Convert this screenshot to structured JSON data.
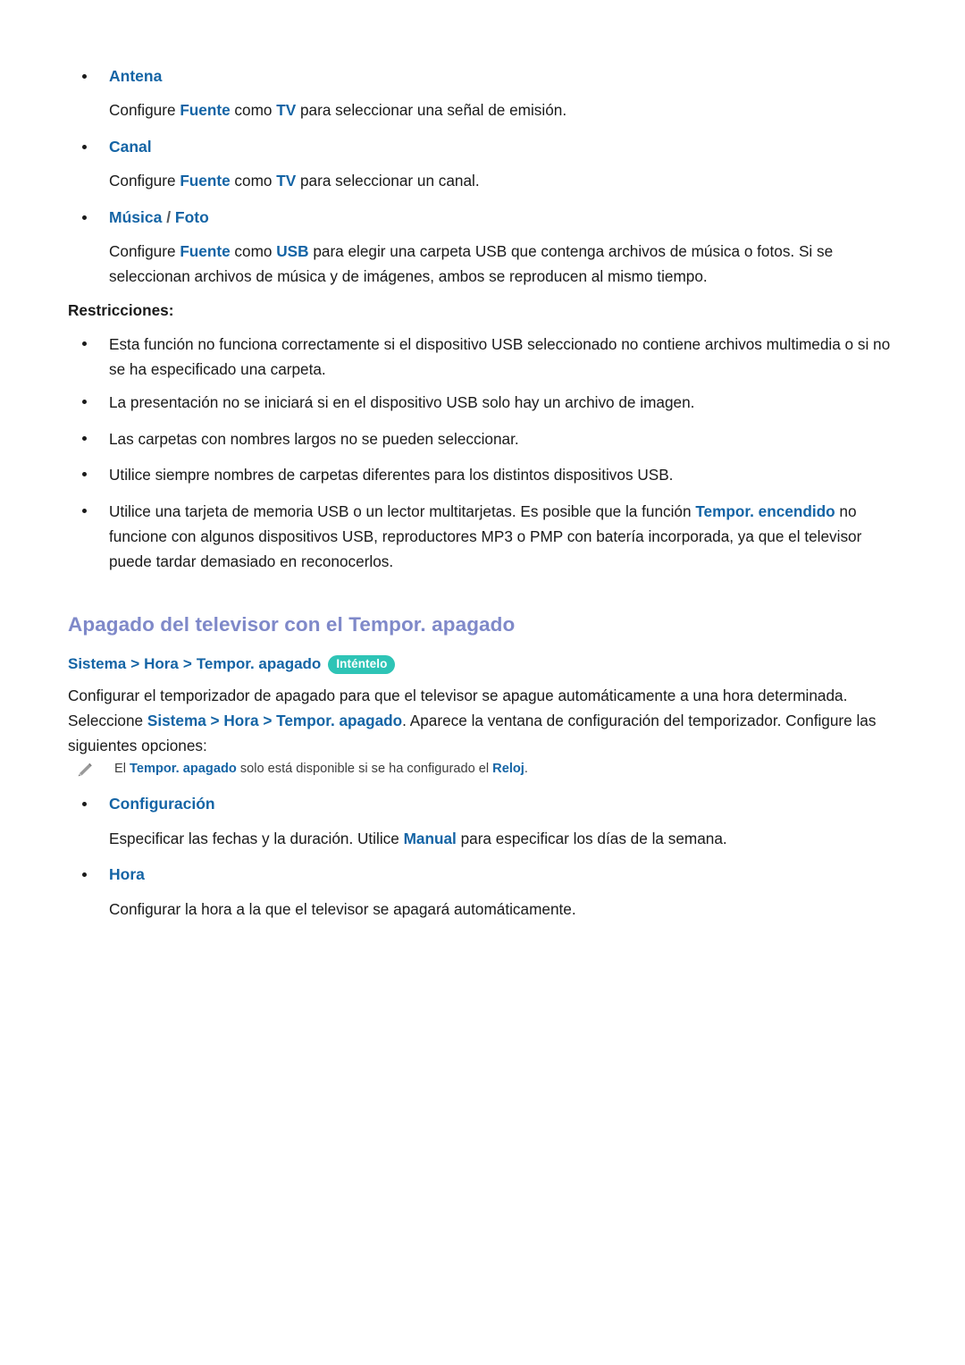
{
  "colors": {
    "link_blue": "#1464a5",
    "heading_purple": "#7f89c9",
    "badge_teal": "#2ec4b6",
    "body_black": "#1a1a1a",
    "note_gray": "#3c3c3c"
  },
  "terms": {
    "antena": "Antena",
    "canal": "Canal",
    "musica": "Música",
    "separator": "/",
    "foto": "Foto",
    "configuracion": "Configuración",
    "hora": "Hora"
  },
  "descriptions": {
    "antena": {
      "p1": "Configure ",
      "k1": "Fuente",
      "p2": " como ",
      "k2": "TV",
      "p3": " para seleccionar una señal de emisión."
    },
    "canal": {
      "p1": "Configure ",
      "k1": "Fuente",
      "p2": " como ",
      "k2": "TV",
      "p3": " para seleccionar un canal."
    },
    "musica_foto": {
      "p1": "Configure ",
      "k1": "Fuente",
      "p2": " como ",
      "k2": "USB",
      "p3": " para elegir una carpeta USB que contenga archivos de música o fotos. Si se seleccionan archivos de música y de imágenes, ambos se reproducen al mismo tiempo."
    },
    "configuracion": {
      "p1": "Especificar las fechas y la duración. Utilice ",
      "k1": "Manual",
      "p2": " para especificar los días de la semana."
    },
    "hora": {
      "p1": "Configurar la hora a la que el televisor se apagará automáticamente."
    }
  },
  "restrictions": {
    "title": "Restricciones:",
    "items": [
      {
        "p1": "Esta función no funciona correctamente si el dispositivo USB seleccionado no contiene archivos multimedia o si no se ha especificado una carpeta."
      },
      {
        "p1": "La presentación no se iniciará si en el dispositivo USB solo hay un archivo de imagen."
      },
      {
        "p1": "Las carpetas con nombres largos no se pueden seleccionar."
      },
      {
        "p1": "Utilice siempre nombres de carpetas diferentes para los distintos dispositivos USB."
      },
      {
        "p1": "Utilice una tarjeta de memoria USB o un lector multitarjetas. Es posible que la función ",
        "k1": "Tempor. encendido",
        "p2": " no funcione con algunos dispositivos USB, reproductores MP3 o PMP con batería incorporada, ya que el televisor puede tardar demasiado en reconocerlos."
      }
    ]
  },
  "section": {
    "heading": "Apagado del televisor con el Tempor. apagado",
    "breadcrumb": {
      "crumb1": "Sistema",
      "arrow1": ">",
      "crumb2": "Hora",
      "arrow2": ">",
      "crumb3": "Tempor. apagado",
      "badge": "Inténtelo"
    },
    "intro": {
      "p1": "Configurar el temporizador de apagado para que el televisor se apague automáticamente a una hora determinada. Seleccione ",
      "k1": "Sistema",
      "p2": " > ",
      "k2": "Hora",
      "p3": " > ",
      "k3": "Tempor. apagado",
      "p4": ". Aparece la ventana de configuración del temporizador. Configure las siguientes opciones:"
    },
    "note": {
      "p1": "El ",
      "k1": "Tempor. apagado",
      "p2": " solo está disponible si se ha configurado el ",
      "k2": "Reloj",
      "p3": "."
    }
  }
}
